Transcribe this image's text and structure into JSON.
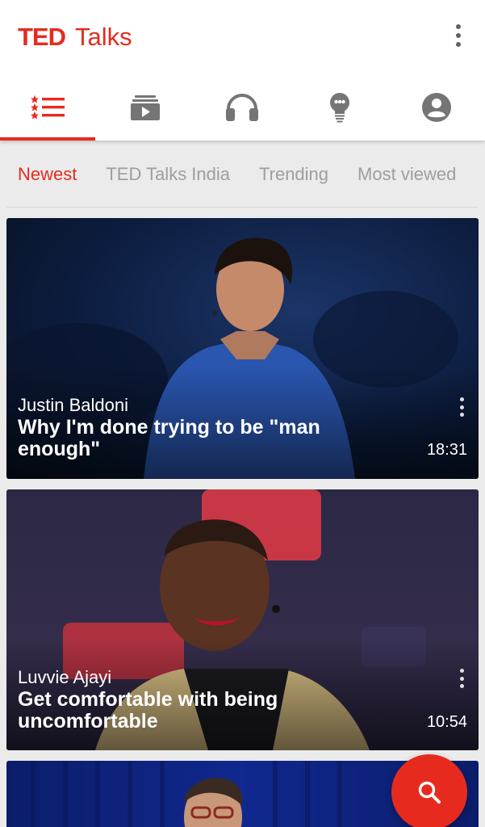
{
  "app": {
    "logo_ted": "TED",
    "logo_talks": "Talks",
    "brand_color": "#e62b1e"
  },
  "nav": [
    {
      "icon": "talks-list-icon",
      "active": true
    },
    {
      "icon": "playlists-icon",
      "active": false
    },
    {
      "icon": "podcasts-headphones-icon",
      "active": false
    },
    {
      "icon": "surprise-me-bulb-icon",
      "active": false
    },
    {
      "icon": "profile-icon",
      "active": false
    }
  ],
  "categories": [
    "Newest",
    "TED Talks India",
    "Trending",
    "Most viewed"
  ],
  "active_category": "Newest",
  "talks": [
    {
      "speaker": "Justin Baldoni",
      "title": "Why I'm done trying to be \"man enough\"",
      "duration": "18:31"
    },
    {
      "speaker": "Luvvie Ajayi",
      "title": "Get comfortable with being uncomfortable",
      "duration": "10:54"
    }
  ],
  "fab": {
    "icon": "search-icon"
  }
}
